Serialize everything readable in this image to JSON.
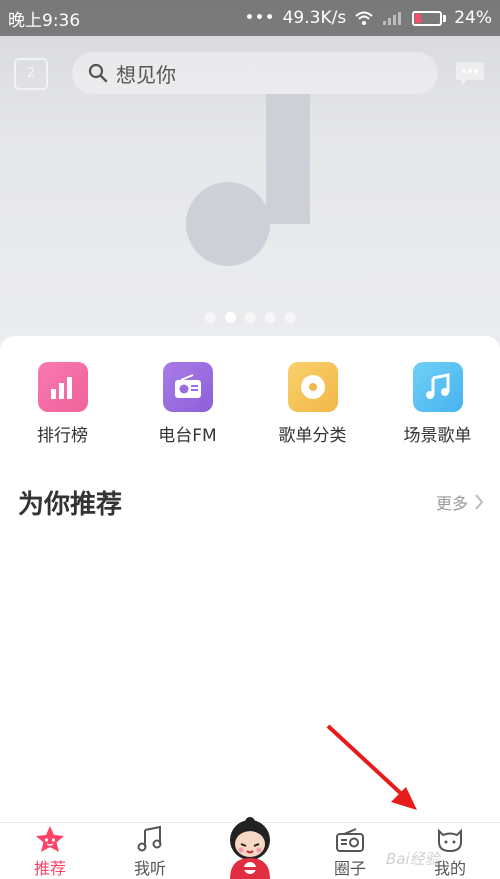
{
  "status_bar": {
    "time": "晚上9:36",
    "dots": "•••",
    "network_speed": "49.3K/s",
    "battery_percent": "24%",
    "battery_level": 0.24,
    "battery_color": "#ff4a6a"
  },
  "search": {
    "placeholder": "想见你",
    "calendar_day": "2"
  },
  "banner": {
    "icon": "music-note-placeholder",
    "dots_total": 5,
    "active_dot_index": 1
  },
  "quick_links": [
    {
      "label": "排行榜",
      "icon": "bar-chart-icon",
      "color": "#f46aa1"
    },
    {
      "label": "电台FM",
      "icon": "radio-icon",
      "color": "#9b6de0"
    },
    {
      "label": "歌单分类",
      "icon": "disc-icon",
      "color": "#f5c25a"
    },
    {
      "label": "场景歌单",
      "icon": "music-note-icon",
      "color": "#5bc2f3"
    }
  ],
  "recommend": {
    "title": "为你推荐",
    "more_label": "更多"
  },
  "bottom_nav": [
    {
      "label": "推荐",
      "icon": "star-icon",
      "active": true
    },
    {
      "label": "我听",
      "icon": "music-note-icon",
      "active": false
    },
    {
      "label": "圈子",
      "icon": "radio-icon",
      "active": false
    },
    {
      "label": "我的",
      "icon": "cat-face-icon",
      "active": false
    }
  ],
  "accent_color": "#ff4266",
  "watermark": "Bai经验"
}
